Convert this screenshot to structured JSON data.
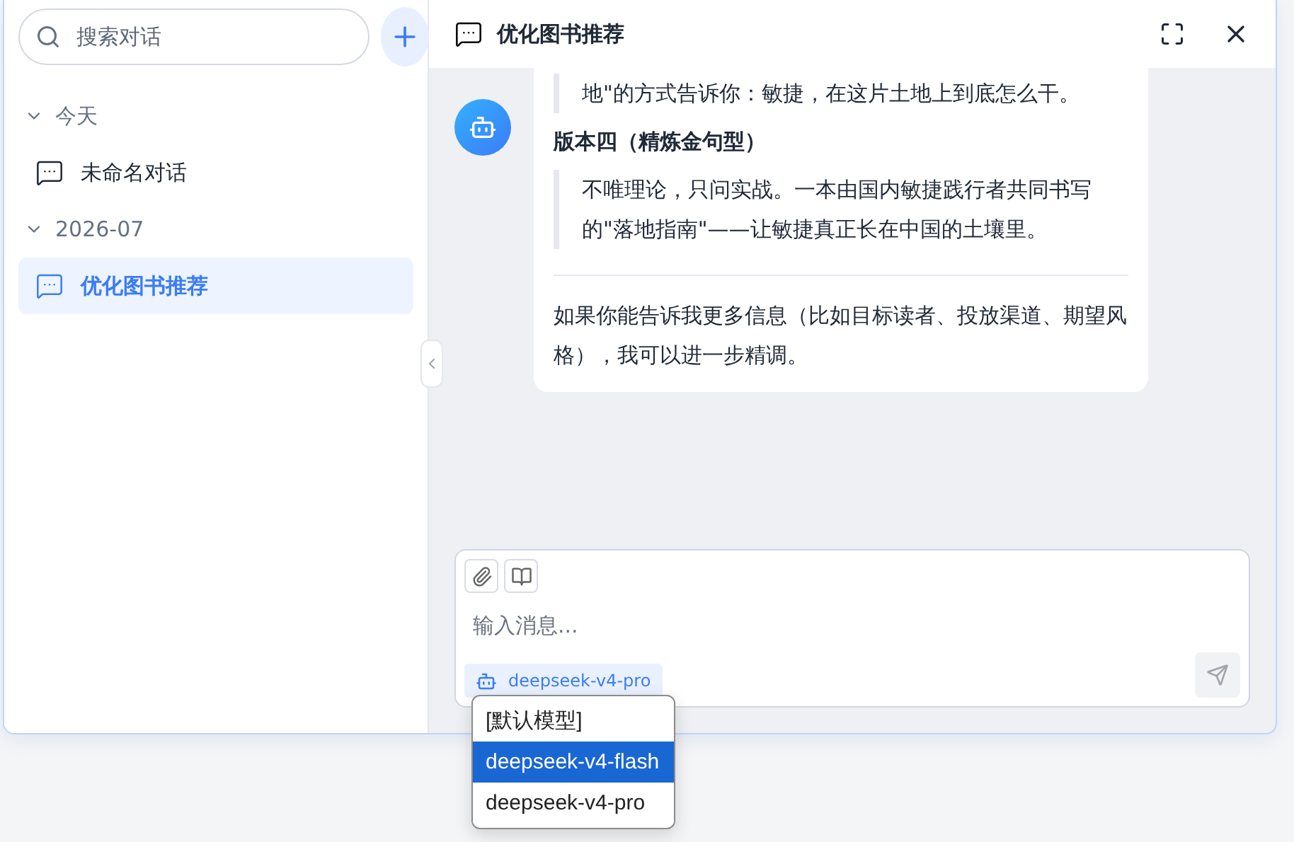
{
  "sidebar": {
    "search": {
      "placeholder": "搜索对话"
    },
    "groups": [
      {
        "label": "今天",
        "expanded": true,
        "children": [
          {
            "title": "未命名对话",
            "selected": false
          }
        ]
      },
      {
        "label": "2026-07",
        "expanded": true,
        "children": [
          {
            "title": "优化图书推荐",
            "selected": true
          }
        ]
      }
    ]
  },
  "chat": {
    "title": "优化图书推荐",
    "blocks": [
      {
        "kind": "quote",
        "text": "地\"的方式告诉你：敏捷，在这片土地上到底怎么干。"
      },
      {
        "kind": "heading",
        "text": "版本四（精炼金句型）"
      },
      {
        "kind": "quote",
        "text": "不唯理论，只问实战。一本由国内敏捷践行者共同书写的\"落地指南\"——让敏捷真正长在中国的土壤里。"
      },
      {
        "kind": "rule"
      },
      {
        "kind": "paragraph",
        "text": "如果你能告诉我更多信息（比如目标读者、投放渠道、期望风格），我可以进一步精调。"
      }
    ]
  },
  "composer": {
    "placeholder": "输入消息...",
    "model": "deepseek-v4-pro",
    "model_menu": [
      {
        "label": "[默认模型]",
        "selected": false
      },
      {
        "label": "deepseek-v4-flash",
        "selected": true
      },
      {
        "label": "deepseek-v4-pro",
        "selected": false
      }
    ]
  }
}
